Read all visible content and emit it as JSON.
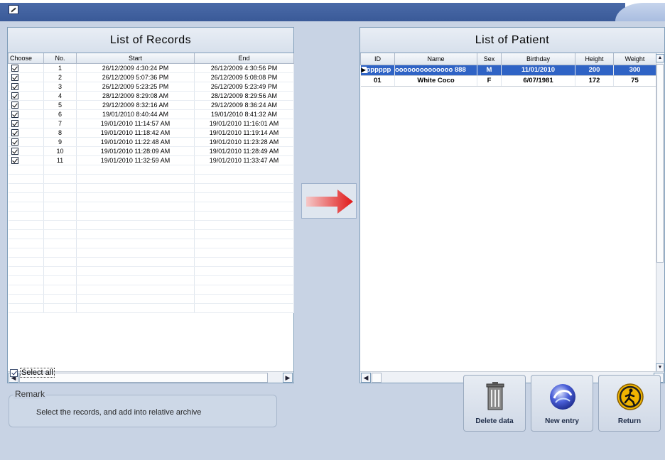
{
  "records": {
    "title": "List of Records",
    "columns": [
      "Choose",
      "No.",
      "Start",
      "End"
    ],
    "rows": [
      {
        "no": "1",
        "start": "26/12/2009 4:30:24 PM",
        "end": "26/12/2009 4:30:56 PM"
      },
      {
        "no": "2",
        "start": "26/12/2009 5:07:36 PM",
        "end": "26/12/2009 5:08:08 PM"
      },
      {
        "no": "3",
        "start": "26/12/2009 5:23:25 PM",
        "end": "26/12/2009 5:23:49 PM"
      },
      {
        "no": "4",
        "start": "28/12/2009 8:29:08 AM",
        "end": "28/12/2009 8:29:56 AM"
      },
      {
        "no": "5",
        "start": "29/12/2009 8:32:16 AM",
        "end": "29/12/2009 8:36:24 AM"
      },
      {
        "no": "6",
        "start": "19/01/2010 8:40:44 AM",
        "end": "19/01/2010 8:41:32 AM"
      },
      {
        "no": "7",
        "start": "19/01/2010 11:14:57 AM",
        "end": "19/01/2010 11:16:01 AM"
      },
      {
        "no": "8",
        "start": "19/01/2010 11:18:42 AM",
        "end": "19/01/2010 11:19:14 AM"
      },
      {
        "no": "9",
        "start": "19/01/2010 11:22:48 AM",
        "end": "19/01/2010 11:23:28 AM"
      },
      {
        "no": "10",
        "start": "19/01/2010 11:28:09 AM",
        "end": "19/01/2010 11:28:49 AM"
      },
      {
        "no": "11",
        "start": "19/01/2010 11:32:59 AM",
        "end": "19/01/2010 11:33:47 AM"
      }
    ]
  },
  "patients": {
    "title": "List of Patient",
    "columns": [
      "ID",
      "Name",
      "Sex",
      "Birthday",
      "Height",
      "Weight"
    ],
    "rows": [
      {
        "id": "pppppp",
        "name": "oooooooooooooo 888",
        "sex": "M",
        "birthday": "11/01/2010",
        "height": "200",
        "weight": "300"
      },
      {
        "id": "01",
        "name": "White Coco",
        "sex": "F",
        "birthday": "6/07/1981",
        "height": "172",
        "weight": "75"
      }
    ]
  },
  "select_all_label": "Select all",
  "remark": {
    "legend": "Remark",
    "text": "Select the records, and add into relative archive"
  },
  "buttons": {
    "delete": "Delete data",
    "new_entry": "New entry",
    "return": "Return"
  }
}
